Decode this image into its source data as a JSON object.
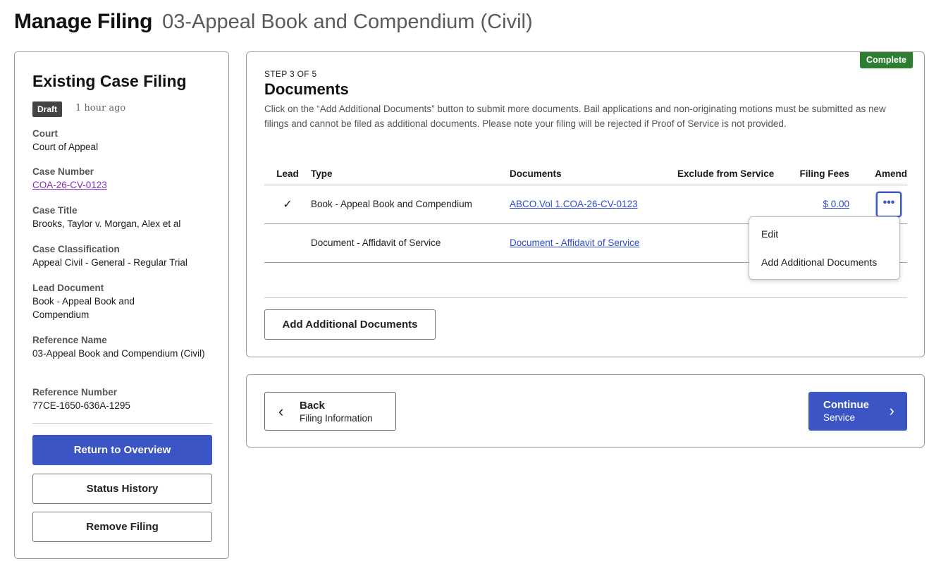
{
  "header": {
    "title": "Manage Filing",
    "subtitle": "03-Appeal Book and Compendium (Civil)"
  },
  "sidebar": {
    "heading": "Existing Case Filing",
    "status_badge": "Draft",
    "time_ago": "1 hour ago",
    "fields": [
      {
        "label": "Court",
        "value": "Court of Appeal"
      },
      {
        "label": "Case Number",
        "value": "COA-26-CV-0123"
      },
      {
        "label": "Case Title",
        "value": "Brooks, Taylor v. Morgan, Alex et al"
      },
      {
        "label": "Case Classification",
        "value": "Appeal Civil - General - Regular Trial"
      },
      {
        "label": "Lead Document",
        "value": "Book - Appeal Book and Compendium"
      },
      {
        "label": "Reference Name",
        "value": "03-Appeal Book and Compendium (Civil)"
      },
      {
        "label": "Reference Number",
        "value": "77CE-1650-636A-1295"
      }
    ],
    "buttons": {
      "overview": "Return to Overview",
      "history": "Status History",
      "remove": "Remove Filing"
    }
  },
  "documents": {
    "complete_badge": "Complete",
    "step": "STEP 3 OF 5",
    "title": "Documents",
    "instructions": "Click on the “Add Additional Documents” button to submit more documents. Bail applications and non-originating motions must be submitted as new filings and cannot be filed as additional documents. Please note your filing will be rejected if Proof of Service is not provided.",
    "columns": {
      "lead": "Lead",
      "type": "Type",
      "documents": "Documents",
      "exclude": "Exclude from Service",
      "fees": "Filing Fees",
      "amend": "Amend"
    },
    "rows": [
      {
        "lead": "✓",
        "type": "Book - Appeal Book and Compendium",
        "document": "ABCO.Vol 1.COA-26-CV-0123",
        "fee": "$ 0.00",
        "amend": "•••"
      },
      {
        "lead": "",
        "type": "Document - Affidavit of Service",
        "document": "Document - Affidavit of Service",
        "fee": "",
        "amend": ""
      }
    ],
    "add_button": "Add Additional Documents",
    "menu": {
      "edit": "Edit",
      "add": "Add Additional Documents"
    }
  },
  "navigation": {
    "back_label": "Back",
    "back_sub": "Filing Information",
    "continue_label": "Continue",
    "continue_sub": "Service"
  },
  "colors": {
    "primary": "#3b55c4",
    "success": "#2d7d32",
    "link": "#2e4bd4",
    "visited_link": "#8a2bbf"
  }
}
